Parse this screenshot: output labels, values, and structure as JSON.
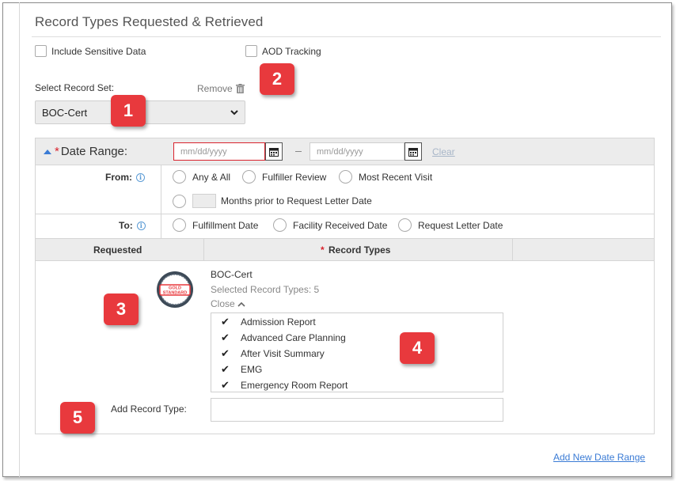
{
  "section": {
    "title": "Record Types Requested & Retrieved"
  },
  "options": {
    "include_sensitive": "Include Sensitive Data",
    "aod_tracking": "AOD Tracking"
  },
  "record_set": {
    "label": "Select Record Set:",
    "remove_label": "Remove",
    "selected": "BOC-Cert"
  },
  "badges": [
    "1",
    "2",
    "3",
    "4",
    "5"
  ],
  "date_range": {
    "title": "Date Range:",
    "from_placeholder": "mm/dd/yyyy",
    "to_placeholder": "mm/dd/yyyy",
    "clear_label": "Clear",
    "from_label": "From:",
    "from_options": [
      "Any & All",
      "Fulfiller Review",
      "Most Recent Visit"
    ],
    "months_prior_label": "Months prior to Request Letter Date",
    "to_label": "To:",
    "to_options": [
      "Fulfillment Date",
      "Facility Received Date",
      "Request Letter Date"
    ]
  },
  "table": {
    "col_requested": "Requested",
    "col_record_types": "Record Types"
  },
  "record_types": {
    "gold_badge": "GOLD STANDARD",
    "set_name": "BOC-Cert",
    "selected_count": "Selected Record Types: 5",
    "close_label": "Close",
    "items": [
      "Admission Report",
      "Advanced Care Planning",
      "After Visit Summary",
      "EMG",
      "Emergency Room Report"
    ],
    "add_label": "Add Record Type:"
  },
  "footer": {
    "add_date_range": "Add New Date Range"
  },
  "colors": {
    "badge_red": "#e8393d",
    "link_blue": "#3a7bd5",
    "required_red": "#d9232d"
  }
}
